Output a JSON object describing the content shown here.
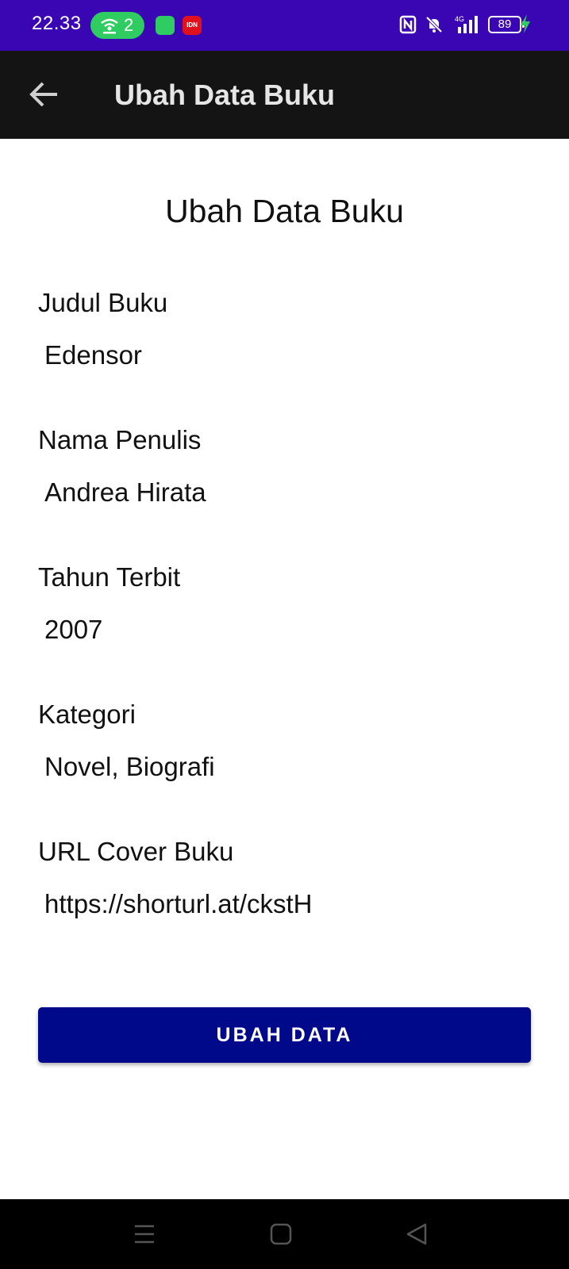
{
  "status_bar": {
    "time": "22.33",
    "hotspot_count": "2",
    "app_badge": "IDN",
    "network": "4G",
    "battery": "89"
  },
  "toolbar": {
    "title": "Ubah Data Buku",
    "back_icon": "arrow-left-icon"
  },
  "form": {
    "heading": "Ubah Data Buku",
    "fields": [
      {
        "label": "Judul Buku",
        "value": "Edensor"
      },
      {
        "label": "Nama Penulis",
        "value": "Andrea Hirata"
      },
      {
        "label": "Tahun Terbit",
        "value": "2007"
      },
      {
        "label": "Kategori",
        "value": "Novel, Biografi"
      },
      {
        "label": "URL Cover Buku",
        "value": "https://shorturl.at/ckstH"
      }
    ],
    "submit_label": "UBAH DATA"
  },
  "colors": {
    "status_bar": "#3a06b3",
    "toolbar": "#141414",
    "button": "#00098a"
  }
}
